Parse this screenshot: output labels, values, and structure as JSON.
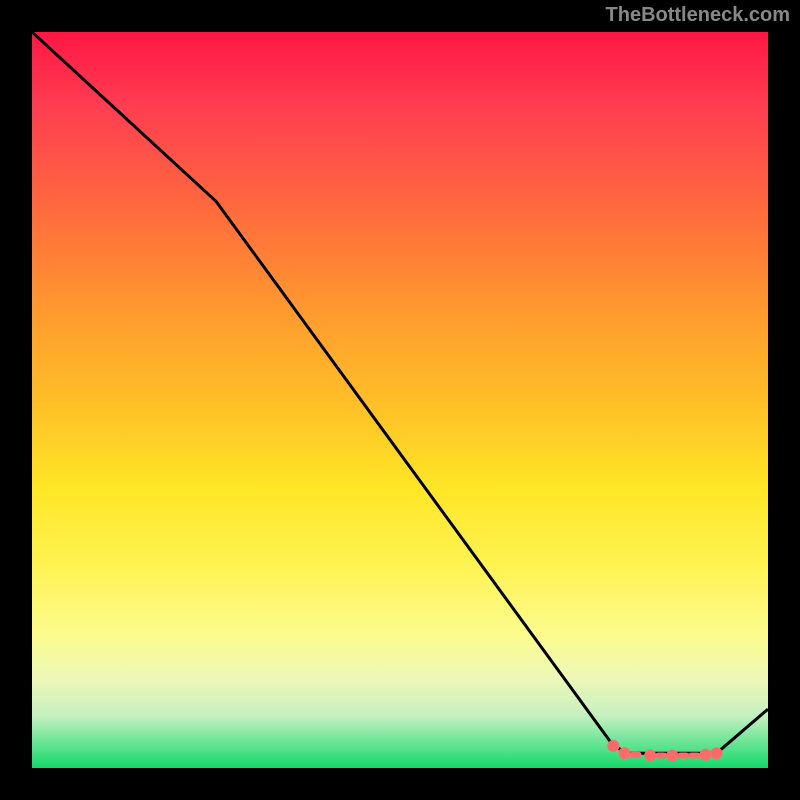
{
  "watermark": "TheBottleneck.com",
  "chart_data": {
    "type": "line",
    "title": "",
    "xlabel": "",
    "ylabel": "",
    "xlim": [
      0,
      100
    ],
    "ylim": [
      0,
      100
    ],
    "series": [
      {
        "name": "curve",
        "color": "#000000",
        "points": [
          {
            "x": 0,
            "y": 100
          },
          {
            "x": 25,
            "y": 77
          },
          {
            "x": 79,
            "y": 3
          },
          {
            "x": 81,
            "y": 2
          },
          {
            "x": 93,
            "y": 2
          },
          {
            "x": 100,
            "y": 8
          }
        ]
      }
    ],
    "markers": [
      {
        "x": 79,
        "y": 3,
        "style": "dot",
        "color": "#ff6b6b"
      },
      {
        "x": 80.5,
        "y": 2,
        "style": "dot",
        "color": "#ff6b6b"
      },
      {
        "x": 82,
        "y": 1.8,
        "style": "dash",
        "color": "#ff6b6b"
      },
      {
        "x": 84,
        "y": 1.7,
        "style": "dot",
        "color": "#ff6b6b"
      },
      {
        "x": 85.5,
        "y": 1.7,
        "style": "dash",
        "color": "#ff6b6b"
      },
      {
        "x": 87,
        "y": 1.7,
        "style": "dot",
        "color": "#ff6b6b"
      },
      {
        "x": 88.5,
        "y": 1.7,
        "style": "dash",
        "color": "#ff6b6b"
      },
      {
        "x": 90,
        "y": 1.7,
        "style": "dash",
        "color": "#ff6b6b"
      },
      {
        "x": 91.5,
        "y": 1.8,
        "style": "dot",
        "color": "#ff6b6b"
      },
      {
        "x": 93,
        "y": 2,
        "style": "dot",
        "color": "#ff6b6b"
      }
    ],
    "gradient_stops": [
      {
        "pos": 0,
        "color": "#ff1744"
      },
      {
        "pos": 50,
        "color": "#ffe626"
      },
      {
        "pos": 100,
        "color": "#13d96a"
      }
    ]
  }
}
